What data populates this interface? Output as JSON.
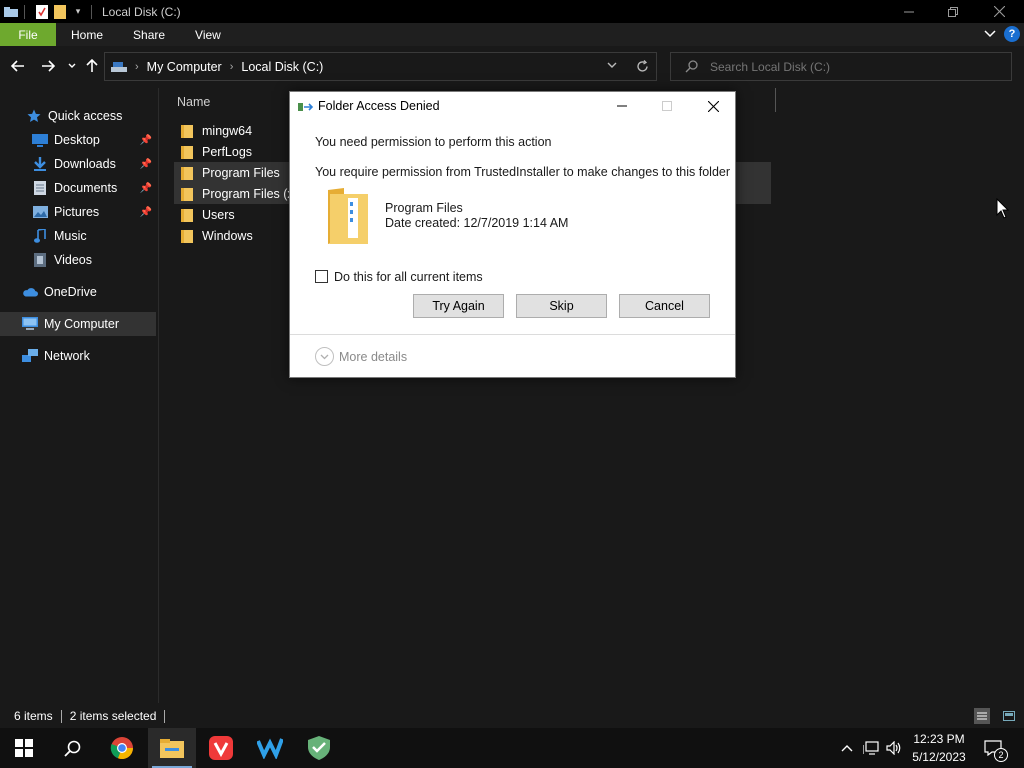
{
  "window": {
    "title": "Local Disk (C:)"
  },
  "ribbon": {
    "tabs": [
      "File",
      "Home",
      "Share",
      "View"
    ]
  },
  "address": {
    "crumbs": [
      "My Computer",
      "Local Disk (C:)"
    ]
  },
  "search": {
    "placeholder": "Search Local Disk (C:)"
  },
  "navpane": {
    "quick_access": "Quick access",
    "items": [
      {
        "label": "Desktop",
        "icon": "desktop-icon",
        "pinned": true
      },
      {
        "label": "Downloads",
        "icon": "downloads-icon",
        "pinned": true
      },
      {
        "label": "Documents",
        "icon": "documents-icon",
        "pinned": true
      },
      {
        "label": "Pictures",
        "icon": "pictures-icon",
        "pinned": true
      },
      {
        "label": "Music",
        "icon": "music-icon",
        "pinned": false
      },
      {
        "label": "Videos",
        "icon": "videos-icon",
        "pinned": false
      }
    ],
    "onedrive": "OneDrive",
    "my_computer": "My Computer",
    "network": "Network"
  },
  "content": {
    "name_header": "Name",
    "files": [
      {
        "name": "mingw64",
        "selected": false
      },
      {
        "name": "PerfLogs",
        "selected": false
      },
      {
        "name": "Program Files",
        "selected": true
      },
      {
        "name": "Program Files (x86)",
        "selected": true
      },
      {
        "name": "Users",
        "selected": false
      },
      {
        "name": "Windows",
        "selected": false
      }
    ]
  },
  "statusbar": {
    "count": "6 items",
    "selected": "2 items selected"
  },
  "dialog": {
    "title": "Folder Access Denied",
    "heading": "You need permission to perform this action",
    "message": "You require permission from TrustedInstaller to make changes to this folder",
    "item_name": "Program Files",
    "item_date": "Date created: 12/7/2019 1:14 AM",
    "checkbox_label": "Do this for all current items",
    "checkbox_checked": false,
    "buttons": {
      "try_again": "Try Again",
      "skip": "Skip",
      "cancel": "Cancel"
    },
    "more_details": "More details"
  },
  "taskbar": {
    "apps": [
      "windows-start-icon",
      "search-icon",
      "chrome-icon",
      "file-explorer-icon",
      "vivaldi-icon",
      "wrike-icon",
      "adguard-icon"
    ],
    "time": "12:23 PM",
    "date": "5/12/2023",
    "notifications": "2"
  },
  "colors": {
    "accent_file_tab": "#6ea92e",
    "background": "#191919",
    "selection": "#333333",
    "folder": "#f2c55c"
  }
}
